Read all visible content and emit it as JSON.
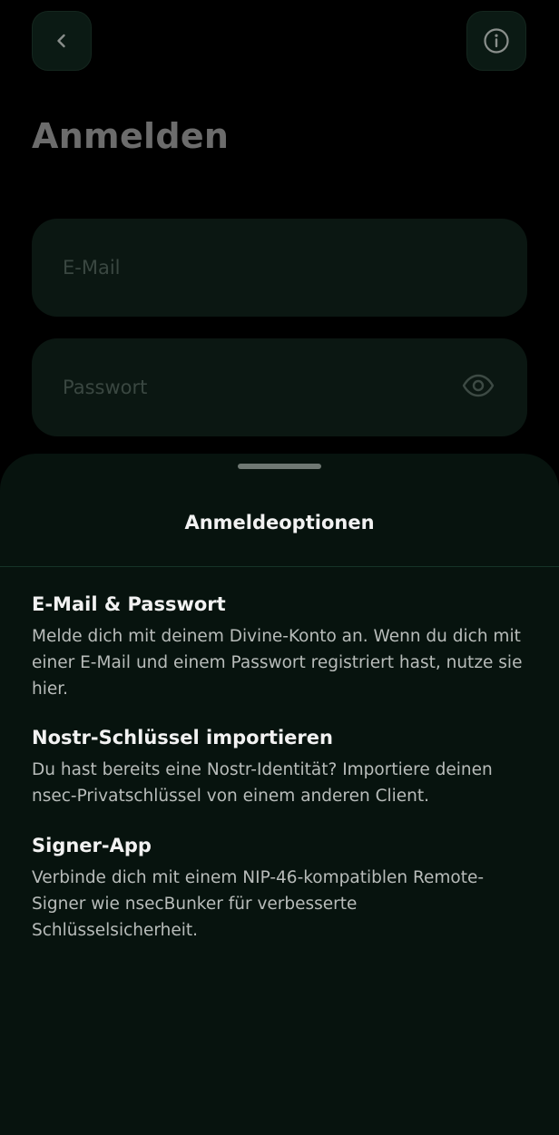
{
  "header": {
    "back_icon": "chevron-left-icon",
    "info_icon": "info-circle-icon"
  },
  "page": {
    "title": "Anmelden"
  },
  "form": {
    "email_placeholder": "E-Mail",
    "password_placeholder": "Passwort",
    "visibility_icon": "eye-icon"
  },
  "sheet": {
    "title": "Anmeldeoptionen",
    "options": [
      {
        "title": "E-Mail & Passwort",
        "description": "Melde dich mit deinem Divine-Konto an. Wenn du dich mit einer E-Mail und einem Passwort registriert hast, nutze sie hier."
      },
      {
        "title": "Nostr-Schlüssel importieren",
        "description": "Du hast bereits eine Nostr-Identität? Importiere deinen nsec-Privatschlüssel von einem anderen Client."
      },
      {
        "title": "Signer-App",
        "description": "Verbinde dich mit einem NIP-46-kompatiblen Remote-Signer wie nsecBunker für verbesserte Schlüsselsicherheit."
      }
    ]
  },
  "colors": {
    "background": "#000000",
    "sheet_background": "#07130e",
    "field_background": "#0b1712",
    "accent_green": "#16352a"
  }
}
